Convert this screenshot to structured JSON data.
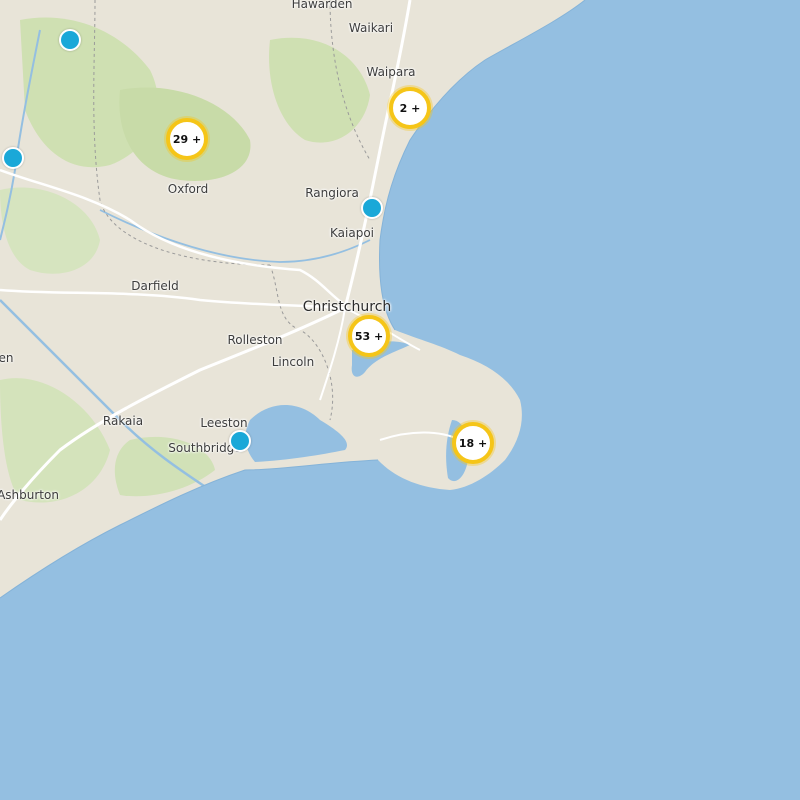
{
  "map": {
    "colors": {
      "water": "#94bfe1",
      "land": "#e8e4d8",
      "forest": "#cfe0b2",
      "road": "#ffffff",
      "river": "#94bfe1"
    },
    "places": {
      "hawarden": "Hawarden",
      "waikari": "Waikari",
      "waipara": "Waipara",
      "oxford": "Oxford",
      "rangiora": "Rangiora",
      "kaiapoi": "Kaiapoi",
      "darfield": "Darfield",
      "christchurch": "Christchurch",
      "rolleston": "Rolleston",
      "lincoln": "Lincoln",
      "leeston": "Leeston",
      "rakaia": "Rakaia",
      "southbridge": "Southbridge",
      "ashburton": "Ashburton",
      "partial_left": "en"
    },
    "clusters": {
      "c29": "29 +",
      "c2": "2 +",
      "c53": "53 +",
      "c18": "18 +"
    }
  }
}
